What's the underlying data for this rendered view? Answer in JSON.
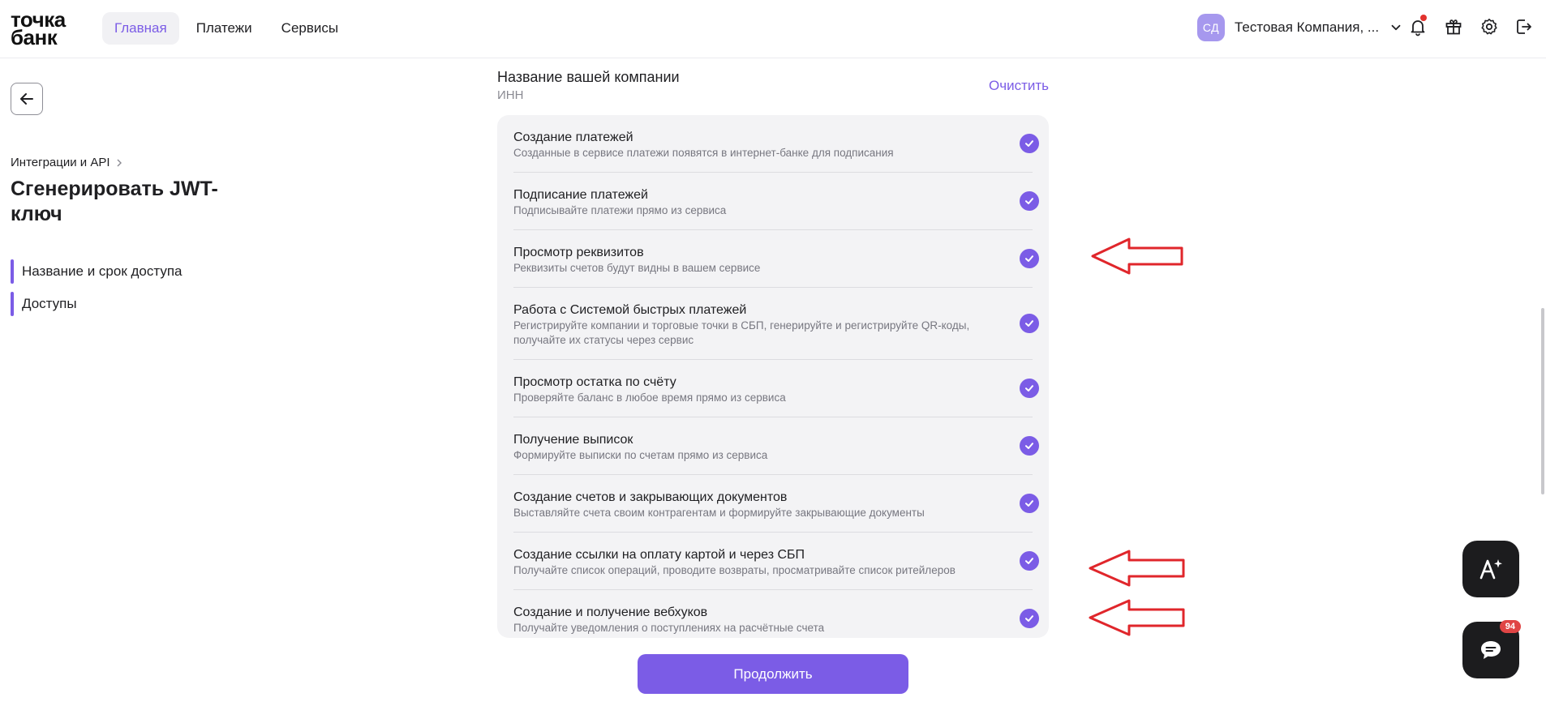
{
  "logo": {
    "line1": "точка",
    "line2": "банк"
  },
  "nav": [
    {
      "label": "Главная",
      "active": true
    },
    {
      "label": "Платежи",
      "active": false
    },
    {
      "label": "Сервисы",
      "active": false
    }
  ],
  "user": {
    "initials": "СД",
    "company": "Тестовая Компания, ..."
  },
  "breadcrumb": "Интеграции и API",
  "page_title": "Сгенерировать JWT-ключ",
  "steps": [
    "Название и срок доступа",
    "Доступы"
  ],
  "company_section": {
    "title": "Название вашей компании",
    "inn": "ИНН",
    "clear": "Очистить"
  },
  "permissions": [
    {
      "title": "Создание платежей",
      "desc": "Созданные в сервисе платежи появятся в интернет-банке для подписания"
    },
    {
      "title": "Подписание платежей",
      "desc": "Подписывайте платежи прямо из сервиса"
    },
    {
      "title": "Просмотр реквизитов",
      "desc": "Реквизиты счетов будут видны в вашем сервисе"
    },
    {
      "title": "Работа с Системой быстрых платежей",
      "desc": "Регистрируйте компании и торговые точки в СБП, генерируйте и регистрируйте QR-коды, получайте их статусы через сервис"
    },
    {
      "title": "Просмотр остатка по счёту",
      "desc": "Проверяйте баланс в любое время прямо из сервиса"
    },
    {
      "title": "Получение выписок",
      "desc": "Формируйте выписки по счетам прямо из сервиса"
    },
    {
      "title": "Создание счетов и закрывающих документов",
      "desc": "Выставляйте счета своим контрагентам и формируйте закрывающие документы"
    },
    {
      "title": "Создание ссылки на оплату картой и через СБП",
      "desc": "Получайте список операций, проводите возвраты, просматривайте список ритейлеров"
    },
    {
      "title": "Создание и получение вебхуков",
      "desc": "Получайте уведомления о поступлениях на расчётные счета"
    }
  ],
  "continue_label": "Продолжить",
  "chat_badge": "94",
  "colors": {
    "accent": "#7b5ce6",
    "annotation": "#e0262b"
  }
}
